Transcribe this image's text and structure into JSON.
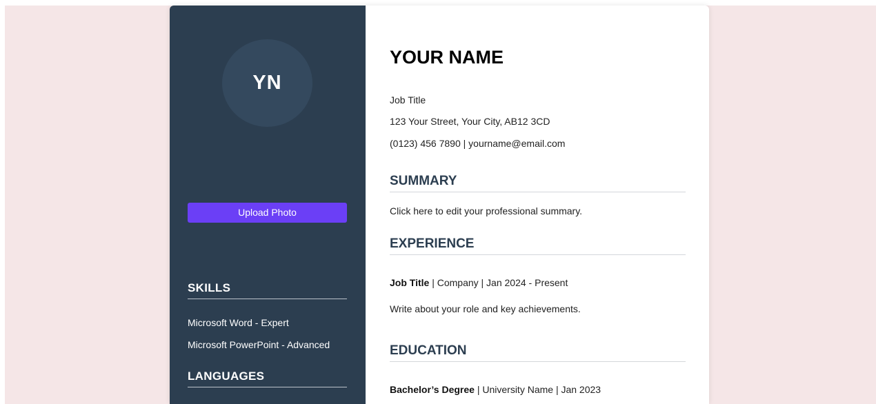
{
  "sidebar": {
    "initials": "YN",
    "upload_label": "Upload Photo",
    "skills_heading": "SKILLS",
    "skills": [
      "Microsoft Word - Expert",
      "Microsoft PowerPoint - Advanced"
    ],
    "languages_heading": "LANGUAGES"
  },
  "header": {
    "name": "YOUR NAME",
    "job_title": "Job Title",
    "address": "123 Your Street, Your City, AB12 3CD",
    "contact": "(0123) 456 7890 | yourname@email.com"
  },
  "summary": {
    "heading": "SUMMARY",
    "text": "Click here to edit your professional summary."
  },
  "experience": {
    "heading": "EXPERIENCE",
    "role": "Job Title",
    "details": " | Company | Jan 2024 - Present",
    "description": "Write about your role and key achievements."
  },
  "education": {
    "heading": "EDUCATION",
    "degree": "Bachelor’s Degree",
    "details": " | University Name | Jan 2023"
  },
  "colors": {
    "sidebar_bg": "#2c3e50",
    "avatar_bg": "#34495e",
    "button_bg": "#6b3ff6",
    "page_bg": "#f5e6e7"
  }
}
